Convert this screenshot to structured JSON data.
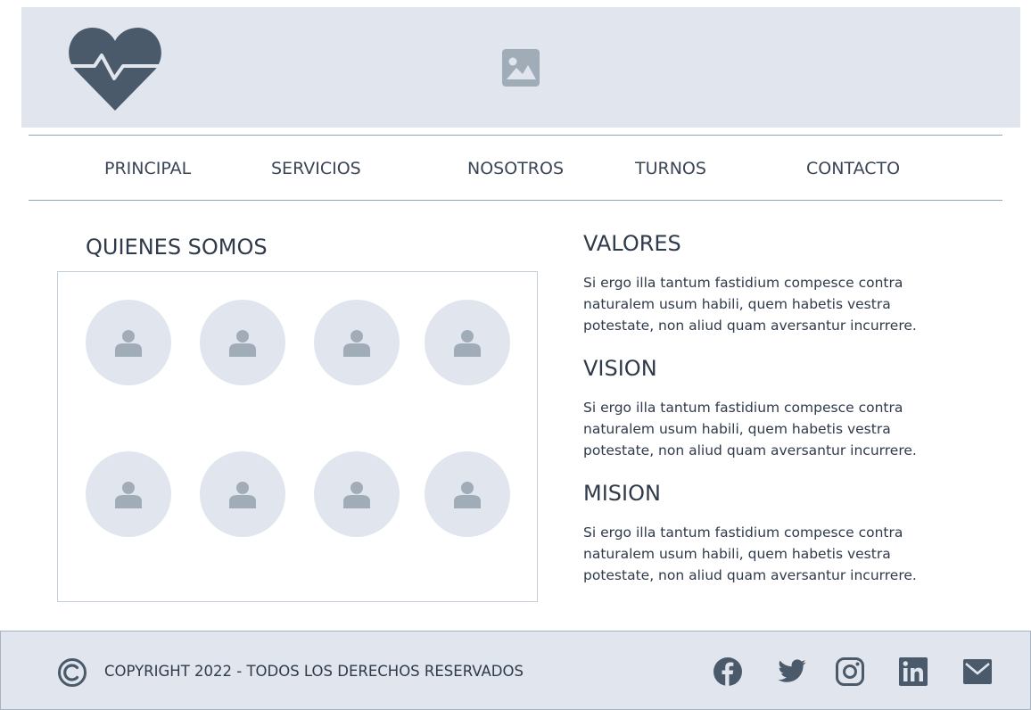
{
  "icons": {
    "logo": "heart-pulse-icon",
    "hero": "image-placeholder-icon",
    "member": "user-icon",
    "copyright": "copyright-icon",
    "social": [
      "facebook-icon",
      "twitter-icon",
      "instagram-icon",
      "linkedin-icon",
      "mail-icon"
    ]
  },
  "colors": {
    "header_bg": "#e1e6ee",
    "icon_dark": "#4b5a6b",
    "icon_muted": "#a0adb9",
    "divider": "#94a4b4"
  },
  "nav": {
    "items": [
      {
        "label": "PRINCIPAL"
      },
      {
        "label": "SERVICIOS"
      },
      {
        "label": "NOSOTROS"
      },
      {
        "label": "TURNOS"
      },
      {
        "label": "CONTACTO"
      }
    ]
  },
  "team": {
    "title": "QUIENES SOMOS",
    "member_count": 8
  },
  "values": {
    "title": "VALORES",
    "text": "Si ergo illa tantum fastidium compesce contra naturalem usum habili, quem habetis vestra potestate, non aliud quam aversantur incurrere."
  },
  "vision": {
    "title": "VISION",
    "text": "Si ergo illa tantum fastidium compesce contra naturalem usum habili, quem habetis vestra potestate, non aliud quam aversantur incurrere."
  },
  "mission": {
    "title": "MISION",
    "text": "Si ergo illa tantum fastidium compesce contra naturalem usum habili, quem habetis vestra potestate, non aliud quam aversantur incurrere."
  },
  "footer": {
    "copyright": "COPYRIGHT 2022 - TODOS LOS DERECHOS RESERVADOS"
  }
}
